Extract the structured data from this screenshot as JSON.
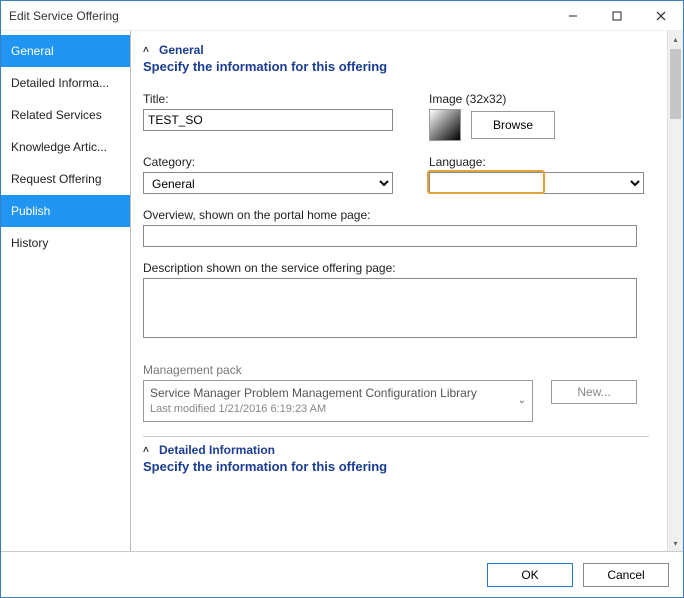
{
  "window": {
    "title": "Edit Service Offering"
  },
  "sidebar": {
    "items": [
      {
        "label": "General"
      },
      {
        "label": "Detailed Informa..."
      },
      {
        "label": "Related Services"
      },
      {
        "label": "Knowledge Artic..."
      },
      {
        "label": "Request Offering"
      },
      {
        "label": "Publish"
      },
      {
        "label": "History"
      }
    ]
  },
  "section": {
    "general": {
      "header": "General",
      "subheader": "Specify the information for this offering",
      "title_label": "Title:",
      "title_value": "TEST_SO",
      "image_label": "Image (32x32)",
      "browse_label": "Browse",
      "category_label": "Category:",
      "category_value": "General",
      "language_label": "Language:",
      "language_value": "",
      "overview_label": "Overview, shown on the portal home page:",
      "overview_value": "",
      "description_label": "Description shown on the service offering page:",
      "description_value": "",
      "mp_label": "Management pack",
      "mp_name": "Service Manager Problem Management Configuration Library",
      "mp_modified": "Last modified  1/21/2016 6:19:23 AM",
      "new_label": "New..."
    },
    "detailed": {
      "header": "Detailed Information",
      "subheader": "Specify the information for this offering"
    }
  },
  "footer": {
    "ok": "OK",
    "cancel": "Cancel"
  }
}
